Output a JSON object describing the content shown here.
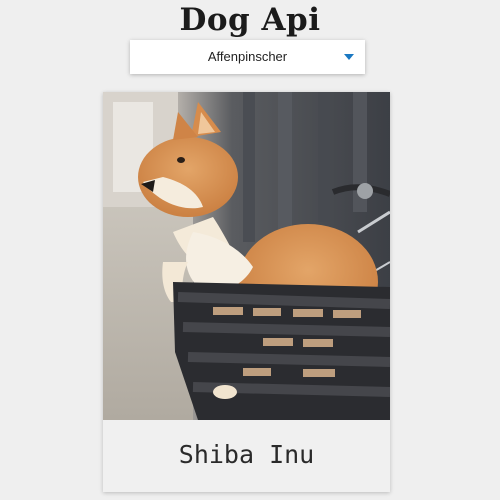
{
  "header": {
    "title": "Dog Api"
  },
  "breed_select": {
    "selected": "Affenpinscher",
    "caret_icon": "caret-down-icon",
    "caret_color": "#1a78c2"
  },
  "dog_card": {
    "image_subject": "shiba-inu-photo",
    "caption": "Shiba Inu"
  }
}
